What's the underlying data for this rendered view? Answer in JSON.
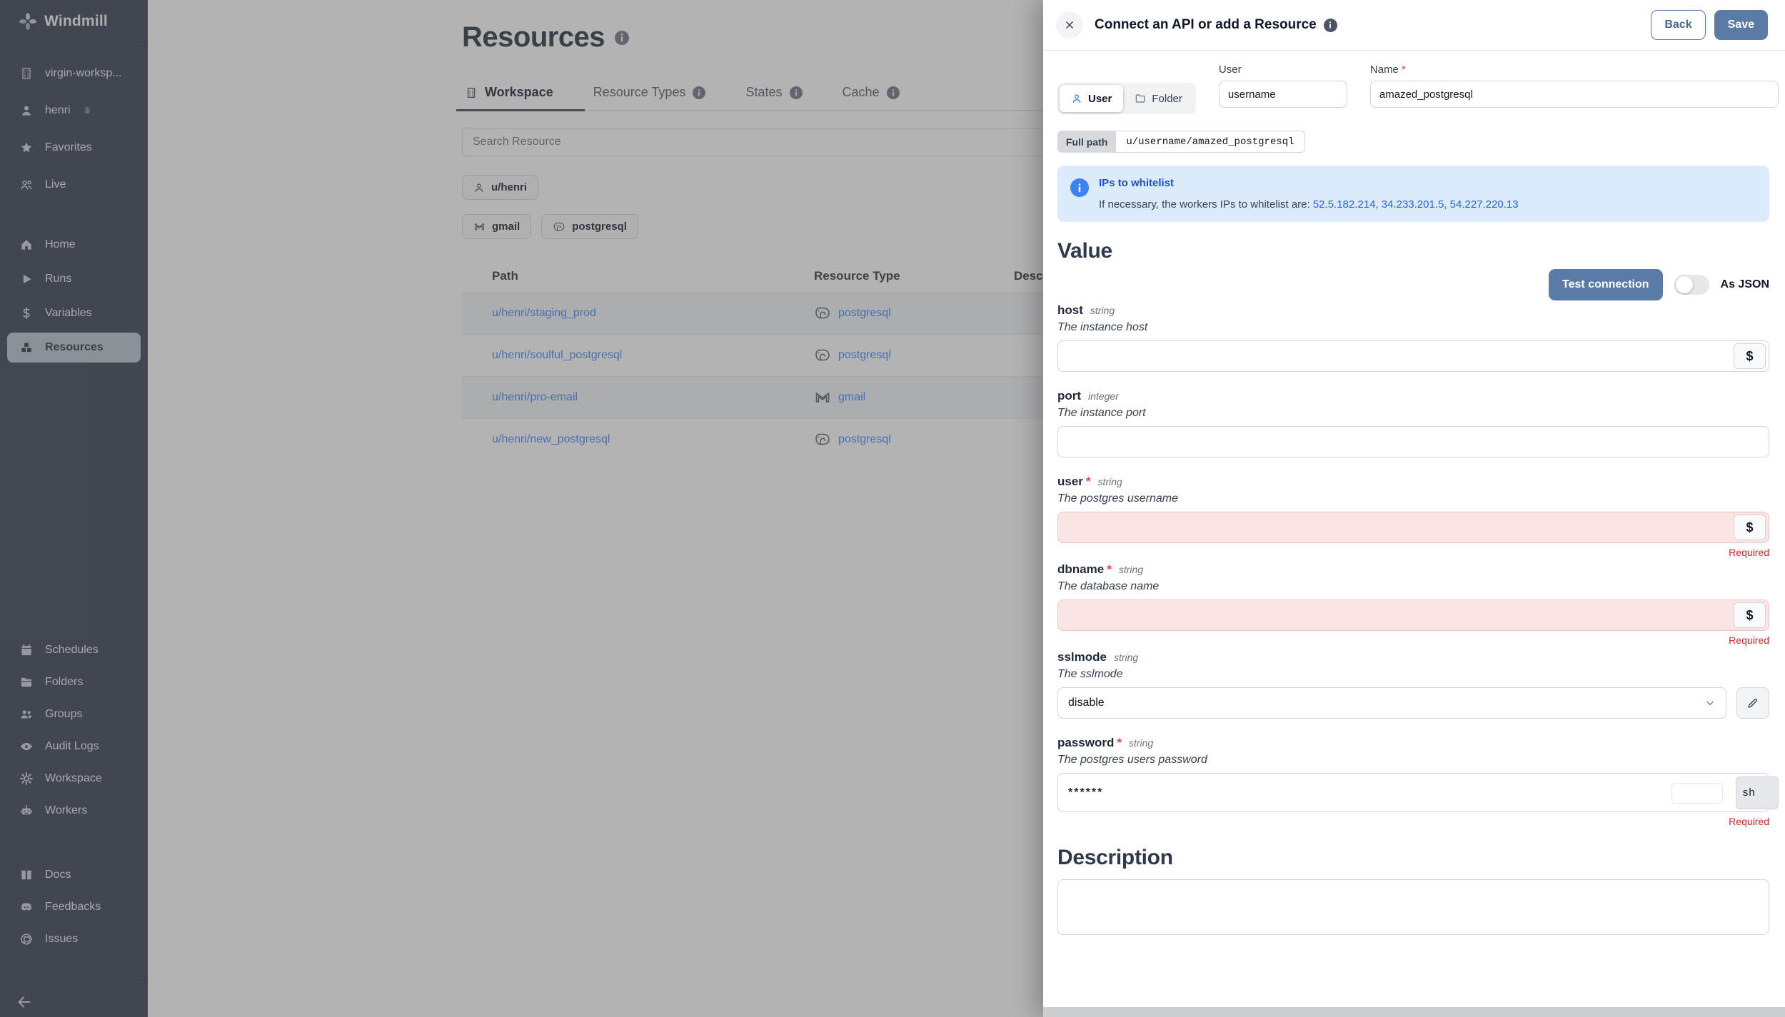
{
  "colors": {
    "accent_blue": "#5b7ba7",
    "link_blue": "#3b82f6",
    "banner_blue": "#1d4ed8",
    "error_red": "#dc2626",
    "invalid_bg": "#fbe4e4",
    "sidebar_bg": "#2e3748"
  },
  "glyphs": {
    "crown": "♕"
  },
  "sidebar": {
    "logo_label": "Windmill",
    "workspace": {
      "label": "virgin-worksp..."
    },
    "account": {
      "label": "henri"
    },
    "top": [
      {
        "label": "Favorites"
      },
      {
        "label": "Live"
      }
    ],
    "nav": [
      {
        "label": "Home"
      },
      {
        "label": "Runs"
      },
      {
        "label": "Variables"
      },
      {
        "label": "Resources"
      }
    ],
    "tools": [
      {
        "label": "Schedules"
      },
      {
        "label": "Folders"
      },
      {
        "label": "Groups"
      },
      {
        "label": "Audit Logs"
      },
      {
        "label": "Workspace"
      },
      {
        "label": "Workers"
      }
    ],
    "help": [
      {
        "label": "Docs"
      },
      {
        "label": "Feedbacks"
      },
      {
        "label": "Issues"
      }
    ]
  },
  "main": {
    "page_title": "Resources",
    "tabs": [
      {
        "label": "Workspace"
      },
      {
        "label": "Resource Types"
      },
      {
        "label": "States"
      },
      {
        "label": "Cache"
      }
    ],
    "search_placeholder": "Search Resource",
    "filters": {
      "owner": "u/henri",
      "type_gmail": "gmail",
      "type_postgresql": "postgresql"
    },
    "table": {
      "headers": [
        "Path",
        "Resource Type",
        "Description"
      ],
      "rows": [
        {
          "path": "u/henri/staging_prod",
          "type": "postgresql"
        },
        {
          "path": "u/henri/soulful_postgresql",
          "type": "postgresql"
        },
        {
          "path": "u/henri/pro-email",
          "type": "gmail"
        },
        {
          "path": "u/henri/new_postgresql",
          "type": "postgresql"
        }
      ]
    }
  },
  "drawer": {
    "title": "Connect an API or add a Resource",
    "back_label": "Back",
    "save_label": "Save",
    "kind_toggle": {
      "user": "User",
      "folder": "Folder"
    },
    "user_input": {
      "label": "User",
      "value": "username"
    },
    "name_input": {
      "label": "Name",
      "required_mark": "*",
      "value": "amazed_postgresql"
    },
    "full_path": {
      "label": "Full path",
      "value": "u/username/amazed_postgresql"
    },
    "banner": {
      "title": "IPs to whitelist",
      "body": "If necessary, the workers IPs to whitelist are: ",
      "ips": "52.5.182.214, 34.233.201.5, 54.227.220.13"
    },
    "value_heading": "Value",
    "test_button": "Test connection",
    "as_json_label": "As JSON",
    "dollar_label": "$",
    "fields": [
      {
        "name": "host",
        "type": "string",
        "desc": "The instance host"
      },
      {
        "name": "port",
        "type": "integer",
        "desc": "The instance port"
      },
      {
        "name": "user",
        "req": "*",
        "type": "string",
        "desc": "The postgres username",
        "error": "Required"
      },
      {
        "name": "dbname",
        "req": "*",
        "type": "string",
        "desc": "The database name",
        "error": "Required"
      },
      {
        "name": "sslmode",
        "type": "string",
        "desc": "The sslmode",
        "value": "disable"
      },
      {
        "name": "password",
        "req": "*",
        "type": "string",
        "desc": "The postgres users password",
        "value": "******",
        "suffix": "sh",
        "error": "Required"
      }
    ],
    "description_heading": "Description"
  }
}
